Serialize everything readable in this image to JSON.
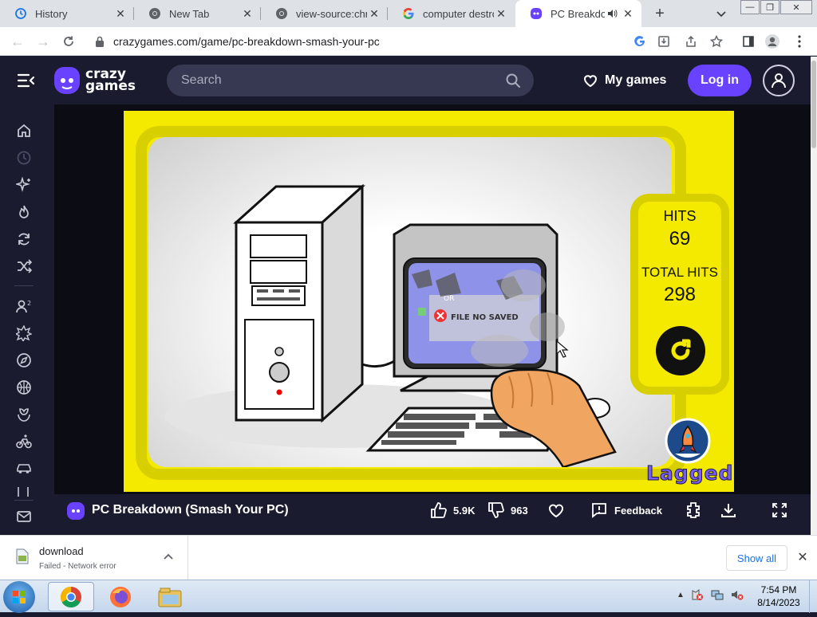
{
  "browser": {
    "tabs": [
      {
        "title": "History",
        "icon": "history-icon"
      },
      {
        "title": "New Tab",
        "icon": "chrome-icon"
      },
      {
        "title": "view-source:chrome",
        "icon": "chrome-icon"
      },
      {
        "title": "computer destroy",
        "icon": "google-icon"
      },
      {
        "title": "PC Breakdow",
        "icon": "crazygames-icon",
        "active": true,
        "audio": true
      }
    ],
    "url": "crazygames.com/game/pc-breakdown-smash-your-pc"
  },
  "site": {
    "logo_line1": "crazy",
    "logo_line2": "games",
    "search_placeholder": "Search",
    "my_games_label": "My games",
    "login_label": "Log in",
    "sidebar_icons": [
      "home-icon",
      "recent-icon",
      "new-icon",
      "trending-icon",
      "updated-icon",
      "random-icon",
      "multiplayer-icon",
      "action-icon",
      "adventure-icon",
      "basketball-icon",
      "beauty-icon",
      "bike-icon",
      "car-icon",
      "card-icon",
      "mail-icon"
    ]
  },
  "game": {
    "hud": {
      "hits_label": "HITS",
      "hits_value": "69",
      "total_label": "TOTAL HITS",
      "total_value": "298"
    },
    "popup_text": "FILE NO SAVED",
    "popup_partial": "OR",
    "sponsor_label": "Lagged"
  },
  "gamebar": {
    "title": "PC Breakdown (Smash Your PC)",
    "likes": "5.9K",
    "dislikes": "963",
    "feedback_label": "Feedback"
  },
  "downloads": {
    "filename": "download",
    "status": "Failed - Network error",
    "show_all_label": "Show all"
  },
  "taskbar": {
    "time": "7:54 PM",
    "date": "8/14/2023"
  },
  "colors": {
    "brand_purple": "#6842ff",
    "site_bg": "#1b1b2f",
    "game_yellow": "#f4ea00"
  }
}
